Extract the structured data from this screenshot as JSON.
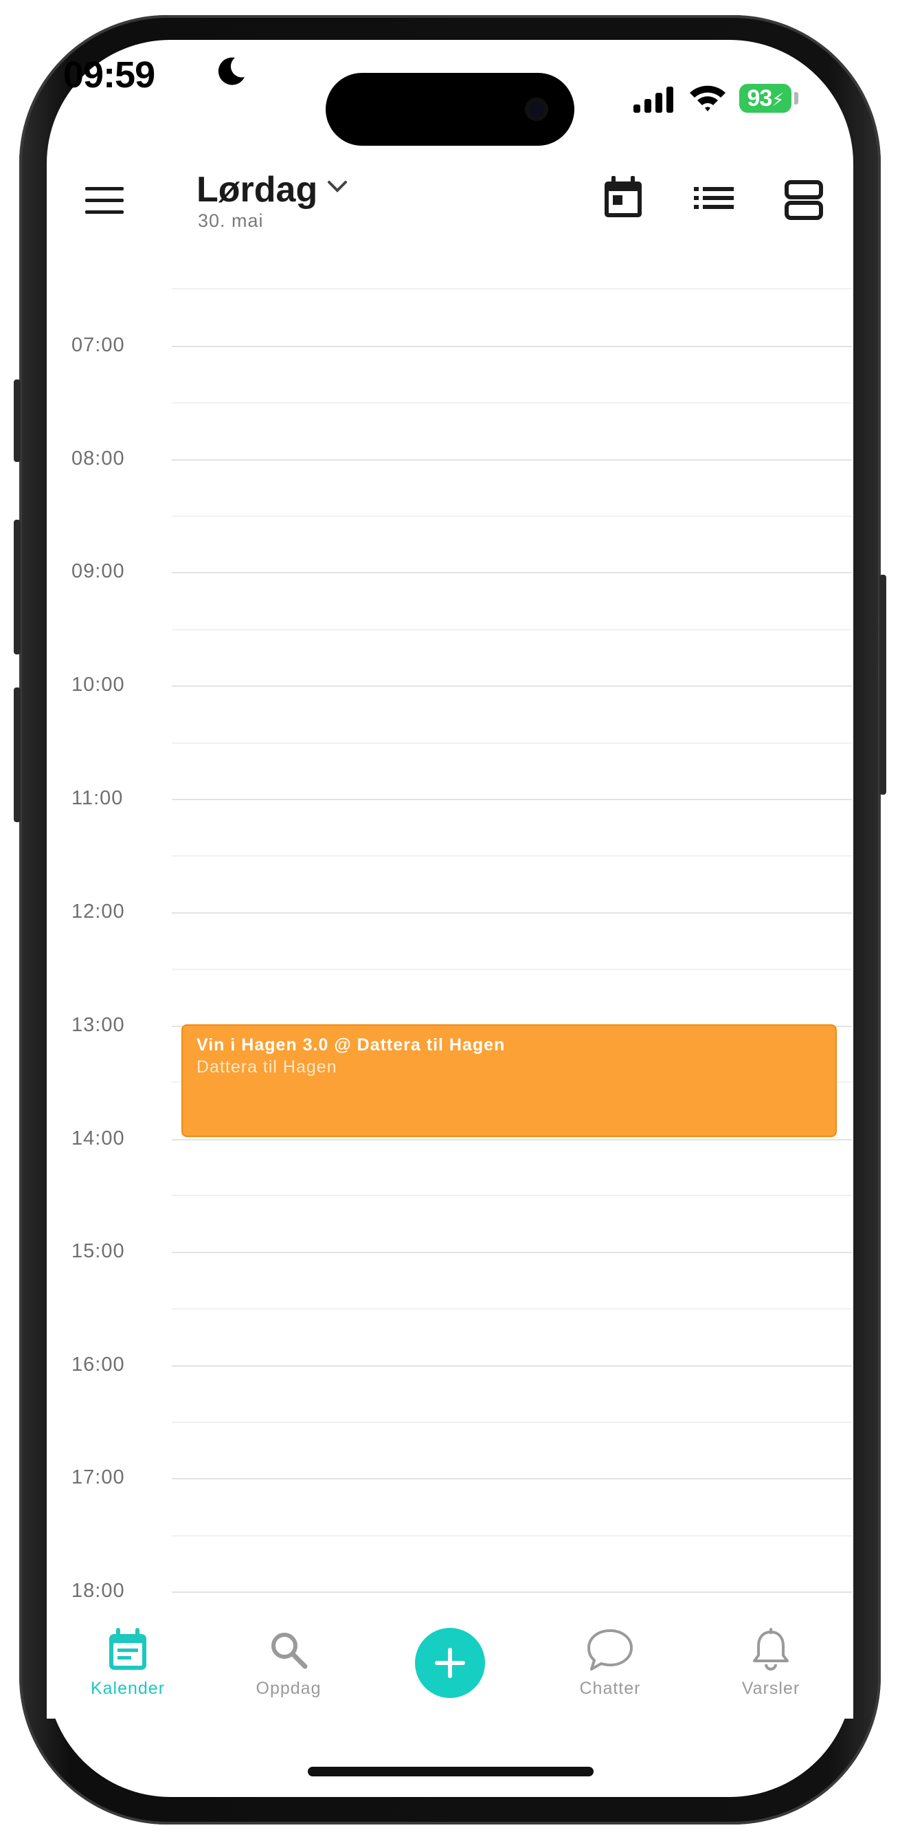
{
  "status_bar": {
    "time": "09:59",
    "battery": "93"
  },
  "header": {
    "day": "Lørdag",
    "date": "30. mai"
  },
  "timeline": {
    "hours": [
      "07:00",
      "08:00",
      "09:00",
      "10:00",
      "11:00",
      "12:00",
      "13:00",
      "14:00",
      "15:00",
      "16:00",
      "17:00",
      "18:00"
    ]
  },
  "event": {
    "title": "Vin i Hagen 3.0 @ Dattera til Hagen",
    "location": "Dattera til Hagen",
    "start": "13:00",
    "end": "14:00",
    "color": "#fba135"
  },
  "tabs": [
    {
      "label": "Kalender",
      "icon": "calendar-icon",
      "active": true
    },
    {
      "label": "Oppdag",
      "icon": "search-icon",
      "active": false
    },
    {
      "label": "Chatter",
      "icon": "chat-bubble-icon",
      "active": false
    },
    {
      "label": "Varsler",
      "icon": "bell-icon",
      "active": false
    }
  ],
  "colors": {
    "accent": "#1cc8bf",
    "event": "#fba135",
    "battery": "#34c759"
  }
}
